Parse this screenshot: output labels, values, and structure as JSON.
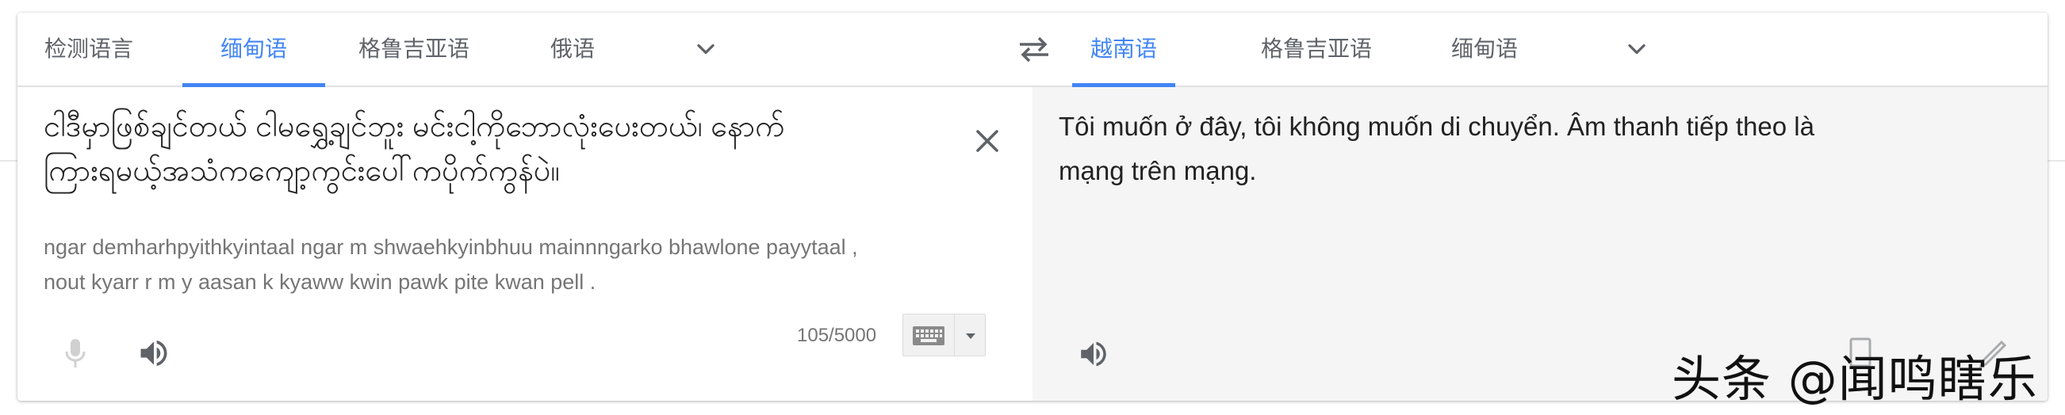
{
  "source_tabs": [
    {
      "label": "检测语言"
    },
    {
      "label": "缅甸语",
      "active": true
    },
    {
      "label": "格鲁吉亚语"
    },
    {
      "label": "俄语"
    }
  ],
  "target_tabs": [
    {
      "label": "越南语",
      "active": true
    },
    {
      "label": "格鲁吉亚语"
    },
    {
      "label": "缅甸语"
    }
  ],
  "source": {
    "text_line1": "ငါဒီမှာဖြစ်ချင်တယ် ငါမရွှေ့ချင်ဘူး မင်းငါ့ကိုဘောလုံးပေးတယ်၊ နောက်",
    "text_line2": "ကြားရမယ့်အသံကကျော့ကွင်းပေါ်ကပိုက်ကွန်ပဲ။",
    "transliteration_line1": "ngar demharhpyithkyintaal  ngar m shwaehkyinbhuu  mainnngarko bhawlone payytaal ,",
    "transliteration_line2": "nout kyarr r m y  aasan k kyaww kwin pawk pite kwan pell .",
    "char_count": "105/5000"
  },
  "target": {
    "text_line1": "Tôi muốn ở đây, tôi không muốn di chuyển. Âm thanh tiếp theo là",
    "text_line2": "mạng trên mạng."
  },
  "watermark": "头条 @闻鸣瞎乐",
  "icons": {
    "more_languages": "chevron-down-icon",
    "swap": "swap-languages-icon",
    "clear": "close-icon",
    "mic": "microphone-icon",
    "listen": "speaker-icon",
    "keyboard": "keyboard-icon"
  },
  "colors": {
    "accent": "#4285f4",
    "text": "#222222",
    "muted": "#757575",
    "target_bg": "#f5f5f5"
  }
}
